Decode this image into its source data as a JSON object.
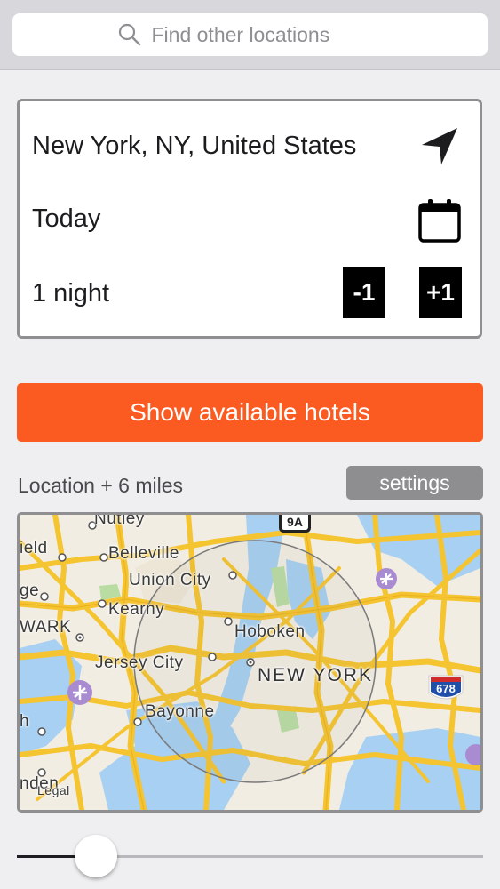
{
  "search": {
    "placeholder": "Find other locations"
  },
  "form": {
    "location": "New York, NY, United States",
    "date": "Today",
    "nights": "1 night",
    "minus_label": "-1",
    "plus_label": "+1"
  },
  "actions": {
    "show_hotels_label": "Show available hotels",
    "settings_label": "settings"
  },
  "radius": {
    "label": "Location + 6 miles",
    "slider_value_fraction": 0.17
  },
  "map": {
    "labels": {
      "nutley": "Nutley",
      "belleville": "Belleville",
      "union_city": "Union City",
      "kearny": "Kearny",
      "hoboken": "Hoboken",
      "jersey_city": "Jersey City",
      "new_york": "NEW YORK",
      "bayonne": "Bayonne",
      "field": "ield",
      "ge": "ge",
      "wark": "WARK",
      "h": "h",
      "nden": "nden",
      "legal": "Legal"
    },
    "shields": {
      "nine_a": "9A",
      "i678": "678"
    },
    "icons": [
      "airport-icon"
    ]
  },
  "colors": {
    "accent": "#fb5a20",
    "settings_bg": "#8e8e91",
    "road": "#f7c42a",
    "water": "#a7d0f2"
  }
}
